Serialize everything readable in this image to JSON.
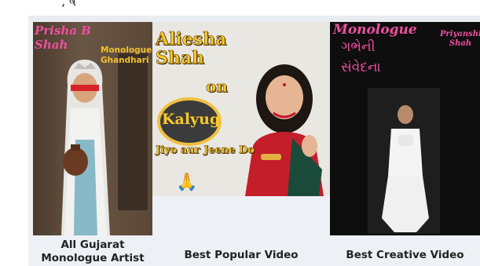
{
  "top_fragment": ", ષ",
  "cards": [
    {
      "name_line1": "Prisha B",
      "name_line2": "Shah",
      "tag_line1": "Monologue",
      "tag_line2": "Ghandhari",
      "caption_line1": "All Gujarat",
      "caption_line2": "Monologue Artist"
    },
    {
      "title": "Aliesha Shah",
      "on": "on",
      "kalyug": "Kalyug",
      "subtitle": "Jiyo aur Jeene Do",
      "icon": "folded-hands-icon",
      "caption": "Best Popular Video"
    },
    {
      "title": "Monologue",
      "gujarati_line1": "ગભેની",
      "gujarati_line2": "સંવેદના",
      "name_line1": "Priyanshi",
      "name_line2": "Shah",
      "caption": "Best Creative Video"
    }
  ],
  "colors": {
    "pink": "#f04ea0",
    "gold": "#f7c92a",
    "label": "#f2c230",
    "caption": "#222222",
    "frame": "#edf0f4"
  }
}
